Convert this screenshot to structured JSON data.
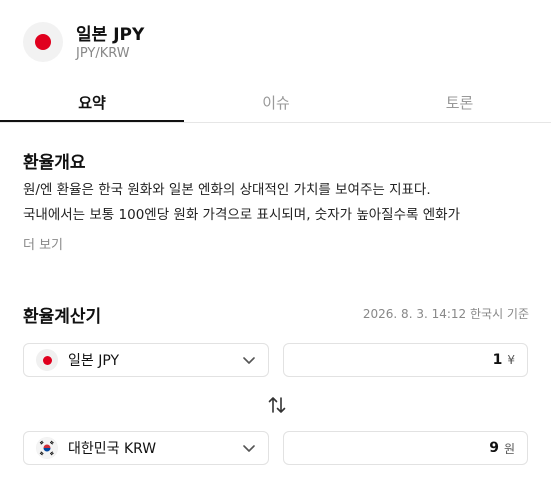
{
  "header": {
    "title": "일본 JPY",
    "subtitle": "JPY/KRW"
  },
  "tabs": [
    {
      "label": "요약",
      "active": true
    },
    {
      "label": "이슈",
      "active": false
    },
    {
      "label": "토론",
      "active": false
    }
  ],
  "overview": {
    "title": "환율개요",
    "lines": [
      "원/엔 환율은 한국 원화와 일본 엔화의 상대적인 가치를 보여주는 지표다.",
      "국내에서는 보통 100엔당 원화 가격으로 표시되며, 숫자가 높아질수록 엔화가"
    ],
    "more_label": "더 보기"
  },
  "calculator": {
    "title": "환율계산기",
    "timestamp": "2026. 8. 3. 14:12 한국시 기준",
    "from": {
      "currency": "일본 JPY",
      "value": "1",
      "unit": "¥"
    },
    "to": {
      "currency": "대한민국 KRW",
      "value": "9",
      "unit": "원"
    }
  },
  "icons": {
    "header_flag": "japan-flag-icon",
    "swap": "swap-arrows-icon",
    "dropdown": "chevron-down-icon"
  },
  "colors": {
    "accent": "#111111",
    "japan_red": "#e0001e",
    "muted": "#888888"
  }
}
